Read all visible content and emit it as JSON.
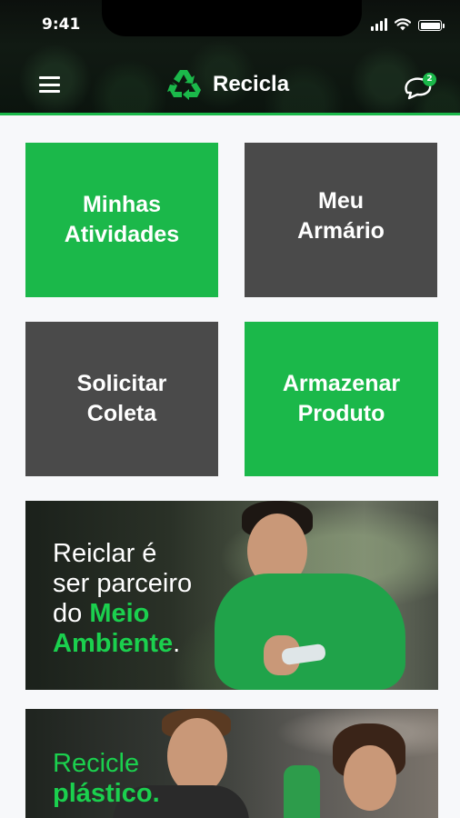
{
  "status_bar": {
    "time": "9:41"
  },
  "app_bar": {
    "title": "Recicla",
    "notification_count": "2",
    "menu_icon": "hamburger-icon",
    "chat_icon": "chat-bubble-icon",
    "logo_icon": "recycle-icon"
  },
  "tiles": [
    {
      "line1": "Minhas",
      "line2": "Atividades",
      "color": "#1bb84a"
    },
    {
      "line1": "Meu",
      "line2": "Armário",
      "color": "#4a4a4a"
    },
    {
      "line1": "Solicitar",
      "line2": "Coleta",
      "color": "#4a4a4a"
    },
    {
      "line1": "Armazenar",
      "line2": "Produto",
      "color": "#1bb84a"
    }
  ],
  "banners": [
    {
      "line1": "Reiclar é",
      "line2": "ser parceiro",
      "line3_prefix": "do ",
      "line3_highlight": "Meio",
      "line4_highlight": "Ambiente",
      "line4_suffix": "."
    },
    {
      "line1_highlight": "Recicle",
      "line2_highlight": "plástico."
    }
  ],
  "colors": {
    "accent": "#1bb84a",
    "dark_tile": "#4a4a4a",
    "background": "#f7f8fa"
  }
}
